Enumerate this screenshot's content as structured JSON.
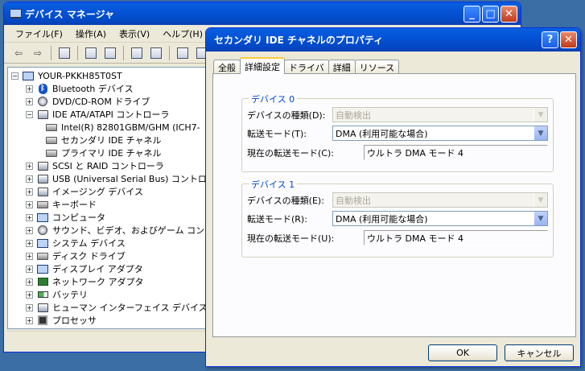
{
  "device_manager": {
    "title": "デバイス マネージャ",
    "menu": [
      "ファイル(F)",
      "操作(A)",
      "表示(V)",
      "ヘルプ(H)"
    ],
    "tree": [
      {
        "label": "YOUR-PKKH85T0ST",
        "level": 0,
        "expander": "−",
        "icon": "computer"
      },
      {
        "label": "Bluetooth デバイス",
        "level": 1,
        "expander": "+",
        "icon": "bluetooth"
      },
      {
        "label": "DVD/CD-ROM ドライブ",
        "level": 1,
        "expander": "+",
        "icon": "disc"
      },
      {
        "label": "IDE ATA/ATAPI コントローラ",
        "level": 1,
        "expander": "−",
        "icon": "controller"
      },
      {
        "label": "Intel(R) 82801GBM/GHM (ICH7-",
        "level": 2,
        "expander": "",
        "icon": "disk"
      },
      {
        "label": "セカンダリ IDE チャネル",
        "level": 2,
        "expander": "",
        "icon": "disk"
      },
      {
        "label": "プライマリ IDE チャネル",
        "level": 2,
        "expander": "",
        "icon": "disk"
      },
      {
        "label": "SCSI と RAID コントローラ",
        "level": 1,
        "expander": "+",
        "icon": "controller"
      },
      {
        "label": "USB (Universal Serial Bus) コントロー",
        "level": 1,
        "expander": "+",
        "icon": "usb"
      },
      {
        "label": "イメージング デバイス",
        "level": 1,
        "expander": "+",
        "icon": "camera"
      },
      {
        "label": "キーボード",
        "level": 1,
        "expander": "+",
        "icon": "keyboard"
      },
      {
        "label": "コンピュータ",
        "level": 1,
        "expander": "+",
        "icon": "computer"
      },
      {
        "label": "サウンド、ビデオ、およびゲーム コントロー",
        "level": 1,
        "expander": "+",
        "icon": "sound"
      },
      {
        "label": "システム デバイス",
        "level": 1,
        "expander": "+",
        "icon": "computer"
      },
      {
        "label": "ディスク ドライブ",
        "level": 1,
        "expander": "+",
        "icon": "disk"
      },
      {
        "label": "ディスプレイ アダプタ",
        "level": 1,
        "expander": "+",
        "icon": "display"
      },
      {
        "label": "ネットワーク アダプタ",
        "level": 1,
        "expander": "+",
        "icon": "network"
      },
      {
        "label": "バッテリ",
        "level": 1,
        "expander": "+",
        "icon": "battery"
      },
      {
        "label": "ヒューマン インターフェイス デバイス",
        "level": 1,
        "expander": "+",
        "icon": "hid"
      },
      {
        "label": "プロセッサ",
        "level": 1,
        "expander": "+",
        "icon": "processor"
      }
    ]
  },
  "dialog": {
    "title": "セカンダリ IDE チャネルのプロパティ",
    "tabs": [
      "全般",
      "詳細設定",
      "ドライバ",
      "詳細",
      "リソース"
    ],
    "active_tab": "詳細設定",
    "device0": {
      "group_label": "デバイス 0",
      "type_label": "デバイスの種類(D):",
      "type_value": "自動検出",
      "mode_label": "転送モード(T):",
      "mode_value": "DMA (利用可能な場合)",
      "current_label": "現在の転送モード(C):",
      "current_value": "ウルトラ DMA モード 4"
    },
    "device1": {
      "group_label": "デバイス 1",
      "type_label": "デバイスの種類(E):",
      "type_value": "自動検出",
      "mode_label": "転送モード(R):",
      "mode_value": "DMA (利用可能な場合)",
      "current_label": "現在の転送モード(U):",
      "current_value": "ウルトラ DMA モード 4"
    },
    "ok_label": "OK",
    "cancel_label": "キャンセル",
    "help_glyph": "?",
    "close_glyph": "✕"
  }
}
